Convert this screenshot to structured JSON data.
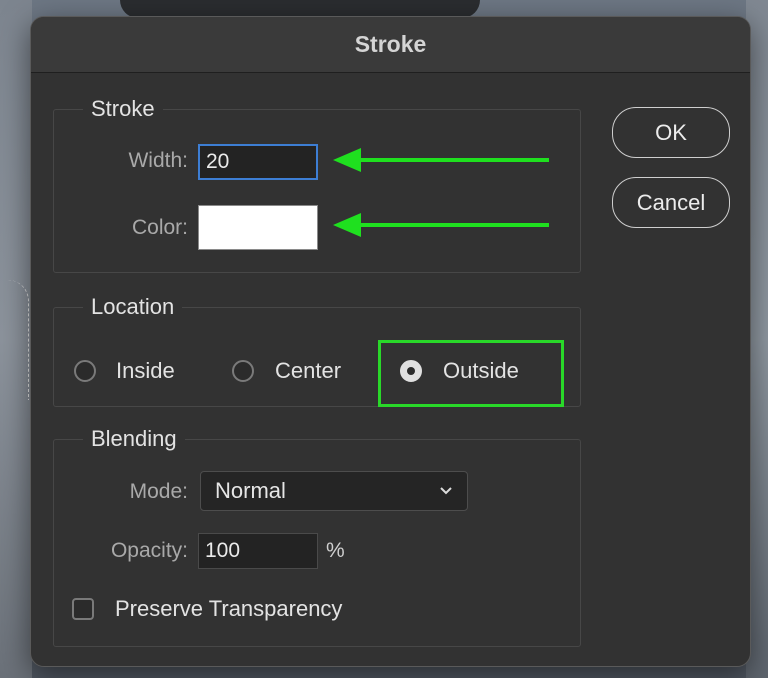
{
  "dialog": {
    "title": "Stroke"
  },
  "stroke_group": {
    "legend": "Stroke",
    "width_label": "Width:",
    "width_value": "20",
    "color_label": "Color:",
    "color_value": "#ffffff"
  },
  "location_group": {
    "legend": "Location",
    "options": [
      {
        "label": "Inside",
        "checked": false
      },
      {
        "label": "Center",
        "checked": false
      },
      {
        "label": "Outside",
        "checked": true
      }
    ]
  },
  "blending_group": {
    "legend": "Blending",
    "mode_label": "Mode:",
    "mode_value": "Normal",
    "opacity_label": "Opacity:",
    "opacity_value": "100",
    "opacity_unit": "%",
    "preserve_label": "Preserve Transparency",
    "preserve_checked": false
  },
  "buttons": {
    "ok_label": "OK",
    "cancel_label": "Cancel"
  },
  "annotations": {
    "arrow_color": "#1fe01f",
    "highlight_color": "#29d829"
  },
  "icons": {
    "dropdown": "chevron-down-icon",
    "arrow": "arrow-left-icon"
  }
}
